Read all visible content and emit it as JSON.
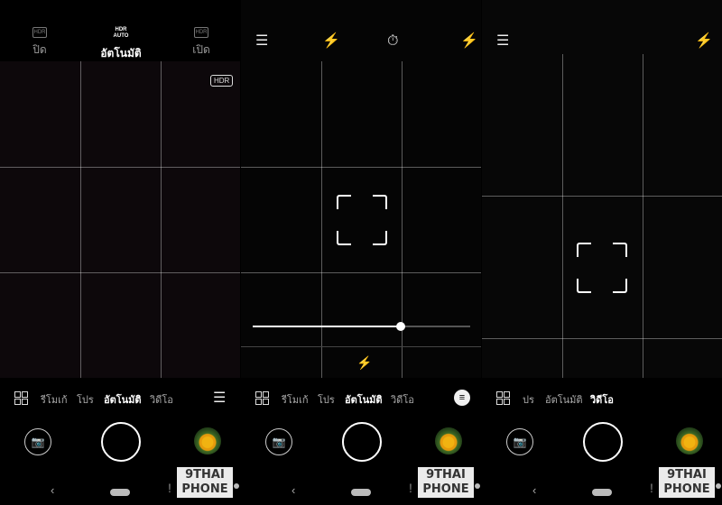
{
  "panel1": {
    "hdr_options": [
      {
        "icon": "hdr-off-icon",
        "label": "ปิด"
      },
      {
        "icon": "hdr-auto-icon",
        "icon_text": "HDR\nAUTO",
        "label": "อัตโนมัติ",
        "selected": true
      },
      {
        "icon": "hdr-on-icon",
        "label": "เปิด"
      }
    ],
    "hdr_badge": "HDR",
    "modes": [
      "รีโมเก้",
      "โปร",
      "อัตโนมัติ",
      "วิดีโอ"
    ],
    "selected_mode": "อัตโนมัติ",
    "settings_icon": "sliders-icon"
  },
  "panel2": {
    "top_icons": [
      "menu-icon",
      "magic-wand-icon",
      "timer-off-icon",
      "flash-off-icon"
    ],
    "modes": [
      "รีโมเก้",
      "โปร",
      "อัตโนมัติ",
      "วิดีโอ"
    ],
    "selected_mode": "อัตโนมัติ",
    "beauty_level": 0.68,
    "menu_icon": "menu-circle-icon"
  },
  "panel3": {
    "top_icons": [
      "menu-icon",
      "flash-off-icon"
    ],
    "modes": [
      "ปร",
      "อัตโนมัติ",
      "วิดีโอ"
    ],
    "selected_mode": "วิดีโอ"
  },
  "watermark": {
    "line1": "9THAI",
    "line2": "PHONE"
  },
  "glyphs": {
    "menu": "☰",
    "wand": "⚡",
    "timer": "⏱",
    "flash_off": "⚡",
    "sliders": "☰",
    "camera": "📷",
    "back": "‹",
    "bang": "!",
    "hdr_auto": "HDR AUTO",
    "hdr_on": "HDR",
    "hdr_off": "HDR",
    "lines": "≡"
  }
}
